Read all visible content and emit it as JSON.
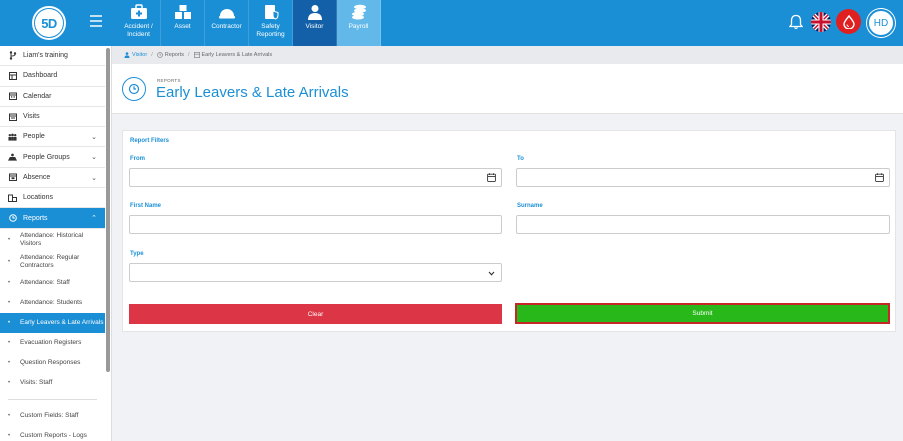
{
  "header": {
    "logo_text": "5D",
    "modules": [
      {
        "label": "Accident / Incident",
        "icon": "first-aid-kit-icon"
      },
      {
        "label": "Asset",
        "icon": "boxes-icon"
      },
      {
        "label": "Contractor",
        "icon": "hard-hat-icon"
      },
      {
        "label": "Safety Reporting",
        "icon": "clipboard-shield-icon"
      },
      {
        "label": "Visitor",
        "icon": "person-icon"
      },
      {
        "label": "Payroll",
        "icon": "coins-icon"
      }
    ],
    "avatar_initials": "HD"
  },
  "sidebar": {
    "items": [
      {
        "label": "Liam's training",
        "icon": "branch-icon"
      },
      {
        "label": "Dashboard",
        "icon": "dashboard-icon"
      },
      {
        "label": "Calendar",
        "icon": "calendar-icon"
      },
      {
        "label": "Visits",
        "icon": "visits-icon"
      },
      {
        "label": "People",
        "icon": "people-icon"
      },
      {
        "label": "People Groups",
        "icon": "groups-icon"
      },
      {
        "label": "Absence",
        "icon": "absence-icon"
      },
      {
        "label": "Locations",
        "icon": "building-icon"
      },
      {
        "label": "Reports",
        "icon": "clock-icon"
      }
    ],
    "subitems": [
      "Attendance: Historical Visitors",
      "Attendance: Regular Contractors",
      "Attendance: Staff",
      "Attendance: Students",
      "Early Leavers & Late Arrivals",
      "Evacuation Registers",
      "Question Responses",
      "Visits: Staff",
      "Custom Fields: Staff",
      "Custom Reports - Logs"
    ]
  },
  "breadcrumb": {
    "root": "Visitor",
    "middle": "Reports",
    "current": "Early Leavers & Late Arrivals"
  },
  "page": {
    "kicker": "REPORTS",
    "title": "Early Leavers & Late Arrivals"
  },
  "filters": {
    "title": "Report Filters",
    "from_label": "From",
    "to_label": "To",
    "first_name_label": "First Name",
    "surname_label": "Surname",
    "type_label": "Type",
    "from_value": "",
    "to_value": "",
    "first_name_value": "",
    "surname_value": "",
    "type_value": "",
    "clear_label": "Clear",
    "submit_label": "Submit"
  },
  "colors": {
    "brand": "#1b8fd6",
    "clear": "#dc3545",
    "submit": "#28b81a",
    "submit_outline": "#c62828"
  }
}
